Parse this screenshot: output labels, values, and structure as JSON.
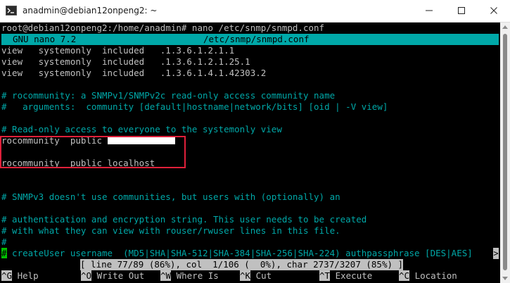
{
  "window": {
    "title": "anadmin@debian12onpeng2: ~"
  },
  "terminal": {
    "prompt_line": "root@debian12onpeng2:/home/anadmin# nano /etc/snmp/snmpd.conf",
    "nano_header": {
      "version": "GNU nano 7.2",
      "filename": "/etc/snmp/snmpd.conf"
    },
    "lines": [
      "view   systemonly  included   .1.3.6.1.2.1.1",
      "view   systemonly  included   .1.3.6.1.2.1.25.1",
      "view   systemonly  included   .1.3.6.1.4.1.42303.2",
      "",
      "# rocommunity: a SNMPv1/SNMPv2c read-only access community name",
      "#   arguments:  community [default|hostname|network/bits] [oid | -V view]",
      "",
      "# Read-only access to everyone to the systemonly view",
      "rocommunity  public ",
      "",
      "rocommunity  public localhost",
      "",
      "",
      "",
      "# SNMPv3 doesn't use communities, but users with (optionally) an",
      "",
      "# authentication and encryption string. This user needs to be created",
      "# with what they can view with rouser/rwuser lines in this file.",
      "#",
      "",
      " createUser username  (MD5|SHA|SHA-512|SHA-384|SHA-256|SHA-224) authpassphrase [DES|AES]"
    ],
    "cursor_char": "#",
    "overflow_char": ">",
    "status": "[ line 77/89 (86%), col  1/106 (  0%), char 2737/3207 (85%) ]",
    "shortcuts": [
      {
        "key": "^G",
        "label": "Help"
      },
      {
        "key": "^O",
        "label": "Write Out"
      },
      {
        "key": "^W",
        "label": "Where Is"
      },
      {
        "key": "^K",
        "label": "Cut"
      },
      {
        "key": "^T",
        "label": "Execute"
      },
      {
        "key": "^C",
        "label": "Location"
      }
    ]
  },
  "colors": {
    "comment": "#00a8a8",
    "text": "#c0c0c0",
    "header_bg": "#00a8a8",
    "highlight_box": "#e0203a",
    "cursor": "#00c000"
  }
}
